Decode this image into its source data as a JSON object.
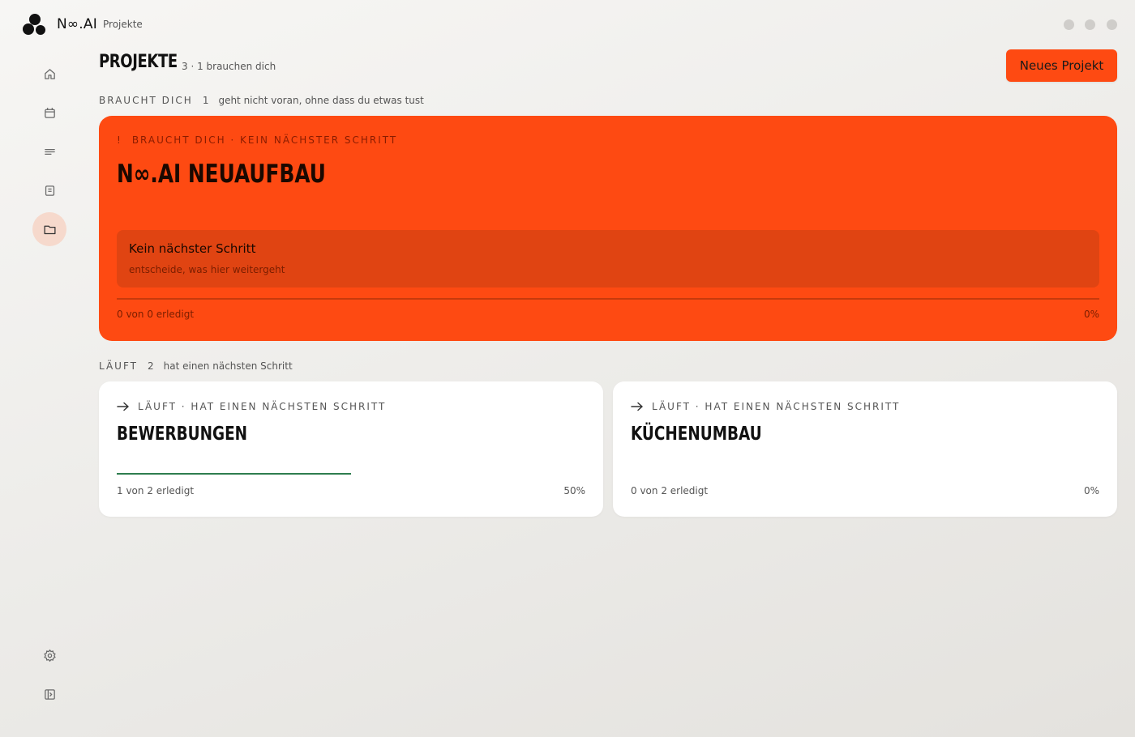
{
  "app": {
    "brand": "N∞.AI",
    "breadcrumb": "Projekte"
  },
  "colors": {
    "accent": "#fe4a12",
    "accent_dark": "#e04412",
    "progress_green": "#2e7d4f",
    "active_nav_bg": "#f6d9cc"
  },
  "sidebar": {
    "items": [
      {
        "name": "home-icon",
        "active": false
      },
      {
        "name": "calendar-icon",
        "active": false
      },
      {
        "name": "list-icon",
        "active": false
      },
      {
        "name": "notes-icon",
        "active": false
      },
      {
        "name": "folder-icon",
        "active": true
      }
    ],
    "bottom": [
      {
        "name": "gear-icon"
      },
      {
        "name": "sidebar-toggle-icon"
      }
    ]
  },
  "header": {
    "title": "Projekte",
    "subtitle": "3 · 1 brauchen dich",
    "new_button": "Neues Projekt"
  },
  "sections": {
    "needs_you": {
      "label": "BRAUCHT DICH",
      "count": "1",
      "desc": "geht nicht voran, ohne dass du etwas tust"
    },
    "running": {
      "label": "LÄUFT",
      "count": "2",
      "desc": "hat einen nächsten Schritt"
    }
  },
  "urgent_project": {
    "status": "BRAUCHT DICH · KEIN NÄCHSTER SCHRITT",
    "status_marker": "!",
    "title": "N∞.AI NEUAUFBAU",
    "step_title": "Kein nächster Schritt",
    "step_sub": "entscheide, was hier weitergeht",
    "progress_text": "0 von 0 erledigt",
    "progress_pct": "0%",
    "progress": 0
  },
  "running_projects": [
    {
      "status": "LÄUFT · HAT EINEN NÄCHSTEN SCHRITT",
      "title": "BEWERBUNGEN",
      "progress_text": "1 von 2 erledigt",
      "progress_pct": "50%",
      "progress": 0.5
    },
    {
      "status": "LÄUFT · HAT EINEN NÄCHSTEN SCHRITT",
      "title": "KÜCHENUMBAU",
      "progress_text": "0 von 2 erledigt",
      "progress_pct": "0%",
      "progress": 0
    }
  ]
}
